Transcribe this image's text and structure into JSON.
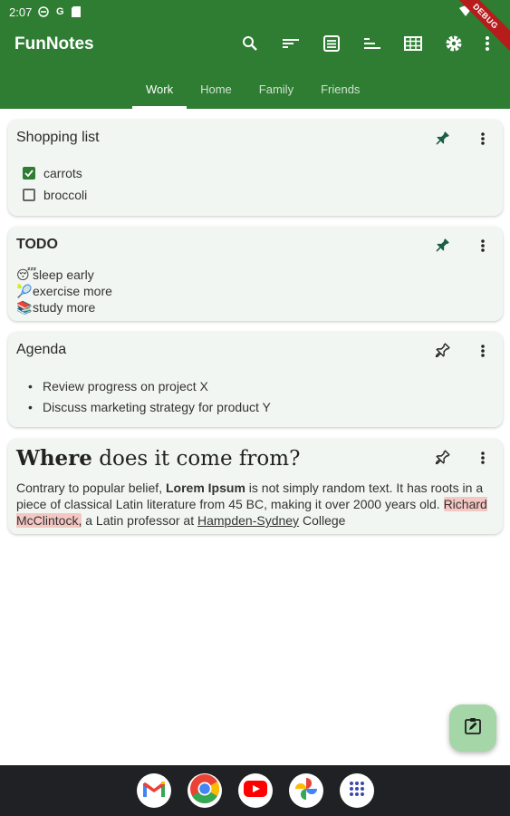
{
  "status": {
    "time": "2:07",
    "icons": [
      "do-not-disturb-icon",
      "google-icon",
      "storage-icon",
      "wifi-icon",
      "battery-icon"
    ]
  },
  "app": {
    "title": "FunNotes",
    "debug_banner": "DEBUG"
  },
  "toolbar": {
    "icons": [
      "search-icon",
      "sort-icon",
      "list-view-icon",
      "sort-bars-icon",
      "grid-view-icon",
      "settings-icon",
      "more-vert-icon"
    ]
  },
  "tabs": [
    {
      "label": "Work",
      "active": true
    },
    {
      "label": "Home",
      "active": false
    },
    {
      "label": "Family",
      "active": false
    },
    {
      "label": "Friends",
      "active": false
    }
  ],
  "notes": {
    "shopping": {
      "title": "Shopping list",
      "pinned": true,
      "items": [
        {
          "label": "carrots",
          "checked": true
        },
        {
          "label": "broccoli",
          "checked": false
        }
      ]
    },
    "todo": {
      "title": "TODO",
      "pinned": true,
      "lines": [
        {
          "emoji": "😴",
          "text": "sleep early"
        },
        {
          "emoji": "🎾",
          "text": "exercise more"
        },
        {
          "emoji": "📚",
          "text": "study more"
        }
      ]
    },
    "agenda": {
      "title": "Agenda",
      "pinned": false,
      "bullets": [
        "Review progress on project X",
        "Discuss marketing strategy for product Y"
      ]
    },
    "where": {
      "title_bold": "Where",
      "title_rest": " does it come from?",
      "pinned": false,
      "body": {
        "p1": "Contrary to popular belief, ",
        "bold": "Lorem Ipsum",
        "p2": " is not simply random text. It has roots in a piece of classical Latin literature from 45 BC, making it over 2000 years old. ",
        "highlight": "Richard McClintock,",
        "p3": " a Latin professor at ",
        "underline": "Hampden-Sydney",
        "p4": " College"
      }
    }
  },
  "colors": {
    "primary": "#2e7d32",
    "card_bg": "#f2f6f2",
    "fab": "#a5d6a7",
    "pin_filled": "#1b5e4a"
  },
  "dock": {
    "apps": [
      "gmail-icon",
      "chrome-icon",
      "youtube-icon",
      "photos-icon",
      "app-drawer-icon"
    ]
  }
}
